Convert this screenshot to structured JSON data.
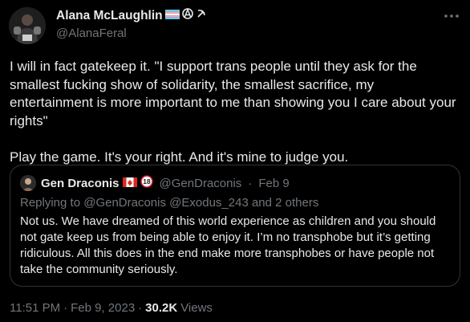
{
  "author": {
    "display_name": "Alana McLaughlin",
    "handle": "@AlanaFeral",
    "badges": [
      "trans-flag-icon",
      "anarchy-symbol-icon",
      "hammer-sickle-icon"
    ]
  },
  "tweet": {
    "text": "I will in fact gatekeep it. \"I support trans people until they ask for the smallest fucking show of solidarity, the smallest sacrifice, my entertainment is more important to me than showing you I care about your rights\"\n\nPlay the game. It's your right. And it's mine to judge you."
  },
  "quoted": {
    "display_name": "Gen Draconis",
    "badges": [
      "canada-flag-icon",
      "18-badge-icon"
    ],
    "handle": "@GenDraconis",
    "separator": "·",
    "date": "Feb 9",
    "replying_label": "Replying to",
    "replying_handles": "@GenDraconis @Exodus_243",
    "replying_and": "and",
    "replying_others": "2 others",
    "text": "Not us. We have dreamed of this world experience as children and you should not gate keep us from being able to enjoy it. I’m no transphobe but it’s getting ridiculous. All this does in the end make more transphobes or have people not take the community seriously."
  },
  "footer": {
    "time": "11:51 PM",
    "separator1": "·",
    "date": "Feb 9, 2023",
    "separator2": "·",
    "views_count": "30.2K",
    "views_label": "Views"
  },
  "colors": {
    "background": "#000000",
    "text": "#e7e9ea",
    "secondary": "#71767b",
    "border": "#2f3336"
  }
}
